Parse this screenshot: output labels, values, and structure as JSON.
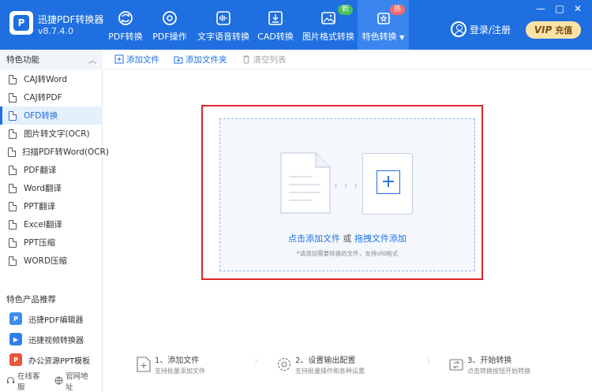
{
  "app": {
    "name": "迅捷PDF转换器",
    "version": "v8.7.4.0",
    "logo_letter": "P"
  },
  "nav": [
    {
      "label": "PDF转换",
      "icon": "refresh-icon"
    },
    {
      "label": "PDF操作",
      "icon": "gear-icon"
    },
    {
      "label": "文字语音转换",
      "icon": "audio-wave-icon"
    },
    {
      "label": "CAD转换",
      "icon": "cad-icon"
    },
    {
      "label": "图片格式转换",
      "icon": "image-icon",
      "badge": "新"
    },
    {
      "label": "特色转换",
      "icon": "star-refresh-icon",
      "badge": "热",
      "active": true,
      "dropdown": "▼"
    }
  ],
  "login": {
    "label": "登录/注册"
  },
  "vip": {
    "tag": "VIP",
    "label": "充值"
  },
  "window_controls": {
    "minimize": "—",
    "maximize": "□",
    "close": "✕"
  },
  "sidebar": {
    "section_title": "特色功能",
    "collapse_glyph": "︿",
    "items": [
      {
        "label": "CAJ转Word"
      },
      {
        "label": "CAJ转PDF"
      },
      {
        "label": "OFD转换",
        "active": true
      },
      {
        "label": "图片转文字(OCR)"
      },
      {
        "label": "扫描PDF转Word(OCR)"
      },
      {
        "label": "PDF翻译"
      },
      {
        "label": "Word翻译"
      },
      {
        "label": "PPT翻译"
      },
      {
        "label": "Excel翻译"
      },
      {
        "label": "PPT压缩"
      },
      {
        "label": "WORD压缩"
      }
    ],
    "products_title": "特色产品推荐",
    "products": [
      {
        "label": "迅捷PDF编辑器",
        "color": "#3b8df0",
        "glyph": "P"
      },
      {
        "label": "迅捷视频转换器",
        "color": "#2f7fe8",
        "glyph": "▶"
      },
      {
        "label": "办公资源PPT模板",
        "color": "#e8573a",
        "glyph": "P"
      }
    ],
    "footer": {
      "support": "在线客服",
      "website": "官网地址"
    }
  },
  "toolbar": {
    "add_file": "添加文件",
    "add_folder": "添加文件夹",
    "clear_list": "清空列表"
  },
  "drop": {
    "arrows": "› › ›",
    "plus": "+",
    "click_add": "点击添加文件",
    "or": " 或 ",
    "drag_add": "拖拽文件添加",
    "hint": "*请添加需要转换的文件，支持ofd格式"
  },
  "steps": [
    {
      "title": "1、添加文件",
      "sub": "支持批量添加文件",
      "icon": "add-file-icon"
    },
    {
      "title": "2、设置输出配置",
      "sub": "支持批量操作和各种设置",
      "icon": "settings-icon"
    },
    {
      "title": "3、开始转换",
      "sub": "点击转换按钮开始转换",
      "icon": "convert-icon"
    }
  ],
  "step_sep": "›",
  "colors": {
    "brand": "#1f6fe0",
    "nav_active": "#3a86ee",
    "highlight": "#e0242a",
    "badge_new": "#49c05a",
    "badge_hot": "#f36b6b"
  }
}
